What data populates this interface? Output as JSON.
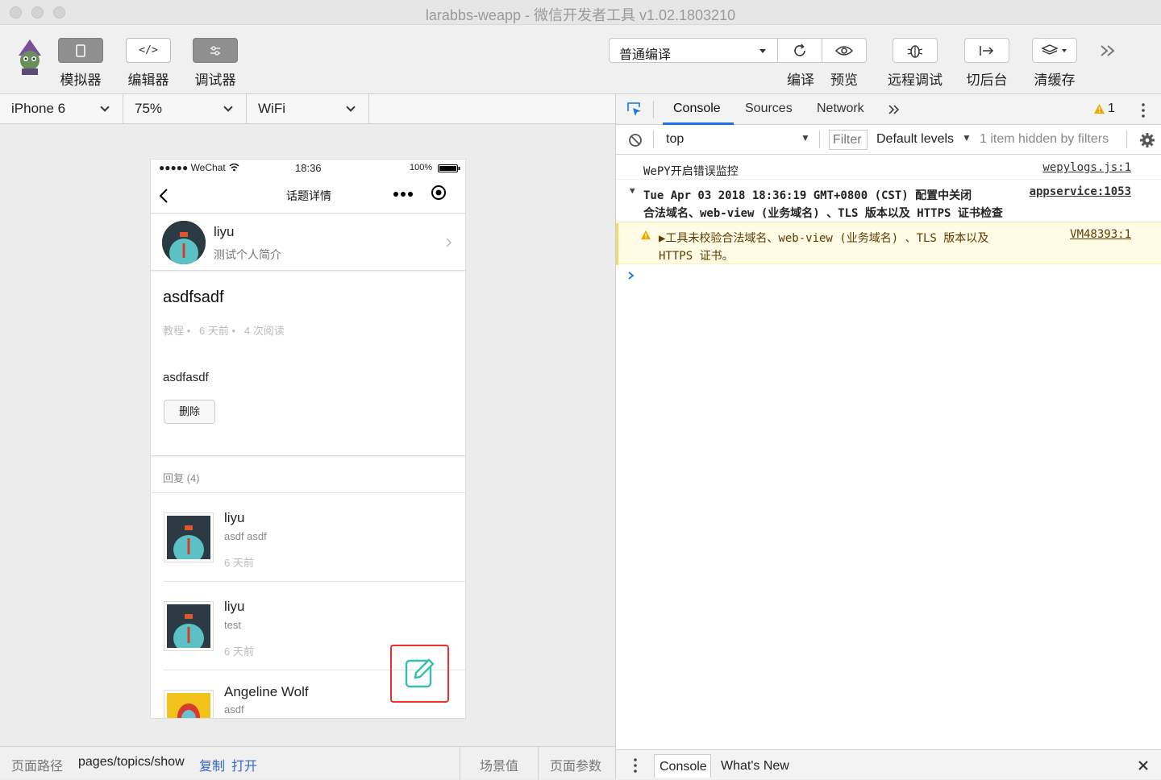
{
  "window": {
    "title": "larabbs-weapp - 微信开发者工具 v1.02.1803210"
  },
  "toolbar": {
    "left_buttons": [
      {
        "label": "模拟器",
        "icon": "phone-icon"
      },
      {
        "label": "编辑器",
        "icon": "code-icon"
      },
      {
        "label": "调试器",
        "icon": "sliders-icon"
      }
    ],
    "compile_mode": "普通编译",
    "compile_label": "编译",
    "preview_label": "预览",
    "remote_debug_label": "远程调试",
    "background_label": "切后台",
    "clear_cache_label": "清缓存"
  },
  "simulator": {
    "device": "iPhone 6",
    "zoom": "75%",
    "network": "WiFi",
    "status": {
      "carrier": "●●●●● WeChat",
      "time": "18:36",
      "battery": "100%"
    },
    "nav_title": "话题详情",
    "author": {
      "name": "liyu",
      "intro": "测试个人简介"
    },
    "topic": {
      "title": "asdfsadf",
      "category": "教程",
      "time": "6 天前",
      "reads": "4 次阅读",
      "body": "asdfasdf",
      "delete_label": "删除"
    },
    "replies_header": "回复 (4)",
    "replies": [
      {
        "name": "liyu",
        "content": "asdf asdf",
        "time": "6 天前"
      },
      {
        "name": "liyu",
        "content": "test",
        "time": "6 天前"
      },
      {
        "name": "Angeline Wolf",
        "content": "asdf",
        "time": ""
      }
    ]
  },
  "footer": {
    "path_label": "页面路径",
    "path": "pages/topics/show",
    "copy_label": "复制",
    "open_label": "打开",
    "scene_label": "场景值",
    "params_label": "页面参数"
  },
  "devtools": {
    "tabs": [
      "Console",
      "Sources",
      "Network"
    ],
    "warning_count": "1",
    "context": "top",
    "filter_placeholder": "Filter",
    "levels": "Default levels",
    "hidden_text": "1 item hidden by filters",
    "logs": [
      {
        "text": "WePY开启错误监控",
        "source": "wepylogs.js:1"
      },
      {
        "text_line1": "Tue Apr 03 2018 18:36:19 GMT+0800 (CST) 配置中关闭",
        "text_line2": "合法域名、web-view (业务域名) 、TLS 版本以及 HTTPS 证书检查",
        "source": "appservice:1053"
      },
      {
        "text_line1": "▶工具未校验合法域名、web-view (业务域名) 、TLS 版本以及",
        "text_line2": "HTTPS 证书。",
        "source": "VM48393:1"
      }
    ],
    "drawer_tabs": [
      "Console",
      "What's New"
    ]
  },
  "colors": {
    "warning_bg": "#fffbe5",
    "warning_text": "#5c3b00",
    "accent": "#1a73e8",
    "link": "#3366cc",
    "fab_border": "#e8302c",
    "fab_icon": "#36bfae"
  }
}
